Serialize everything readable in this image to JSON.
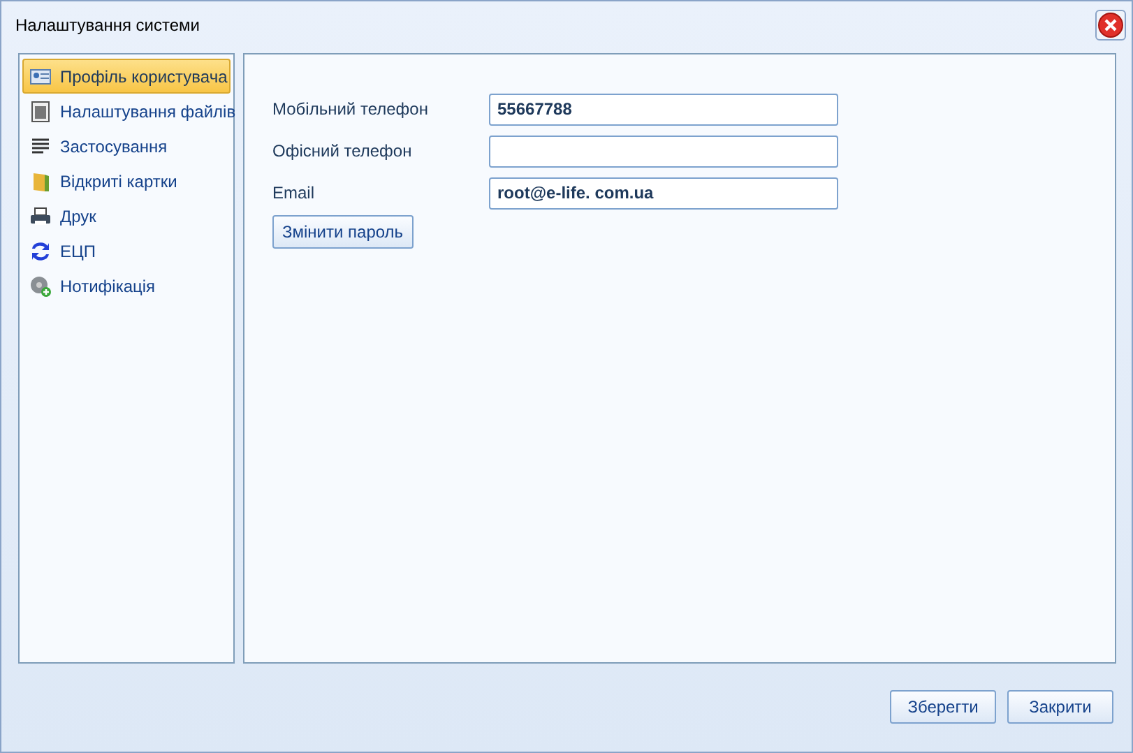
{
  "window": {
    "title": "Налаштування системи"
  },
  "sidebar": {
    "items": [
      {
        "label": "Профіль користувача",
        "selected": true
      },
      {
        "label": "Налаштування файлів",
        "selected": false
      },
      {
        "label": "Застосування",
        "selected": false
      },
      {
        "label": "Відкриті картки",
        "selected": false
      },
      {
        "label": "Друк",
        "selected": false
      },
      {
        "label": "ЕЦП",
        "selected": false
      },
      {
        "label": "Нотифікація",
        "selected": false
      }
    ]
  },
  "form": {
    "fields": [
      {
        "label": "Мобільний телефон",
        "value": "55667788"
      },
      {
        "label": "Офісний телефон"
      },
      {
        "label": "Email",
        "value": "root@e-life. com.ua"
      }
    ],
    "change_password_button": "Змінити пароль"
  },
  "buttons": [
    {
      "label": "Зберегти"
    },
    {
      "label": "Закрити"
    }
  ]
}
